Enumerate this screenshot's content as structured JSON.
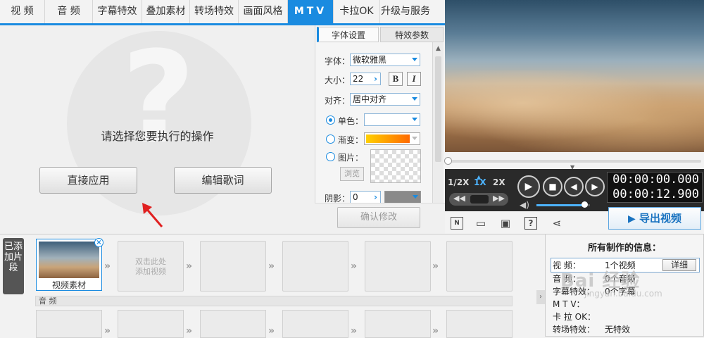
{
  "tabs": [
    {
      "label": "视 频"
    },
    {
      "label": "音 频"
    },
    {
      "label": "字幕特效"
    },
    {
      "label": "叠加素材"
    },
    {
      "label": "转场特效"
    },
    {
      "label": "画面风格"
    },
    {
      "label": "MTV"
    },
    {
      "label": "卡拉OK"
    },
    {
      "label": "升级与服务"
    }
  ],
  "action": {
    "prompt": "请选择您要执行的操作",
    "apply_label": "直接应用",
    "edit_label": "编辑歌词"
  },
  "font_panel": {
    "tab_font": "字体设置",
    "tab_effect": "特效参数",
    "font_label": "字体：",
    "font_value": "微软雅黑",
    "size_label": "大小：",
    "size_value": "22",
    "bold_label": "B",
    "italic_label": "I",
    "align_label": "对齐：",
    "align_value": "居中对齐",
    "solid_label": "单色：",
    "gradient_label": "渐变：",
    "image_label": "图片：",
    "browse_label": "浏览",
    "shadow_label": "阴影：",
    "shadow_value": "0",
    "confirm_label": "确认修改"
  },
  "player": {
    "speed_half": "1/2X",
    "speed_1x": "1X",
    "speed_2x": "2X",
    "time_current": "00:00:00.000",
    "time_total": "00:00:12.900",
    "progress": 0,
    "volume": 0.9,
    "export_label": "导出视频"
  },
  "timeline": {
    "side_label": "已添加片段",
    "clip_name": "视频素材",
    "add_hint_line1": "双击此处",
    "add_hint_line2": "添加视频",
    "audio_label": "音 频"
  },
  "info": {
    "title": "所有制作的信息：",
    "rows": [
      {
        "label": "视  频：",
        "value": "1个视频"
      },
      {
        "label": "音  频：",
        "value": "0个音频"
      },
      {
        "label": "字幕特效：",
        "value": "0个字幕"
      },
      {
        "label": "M  T  V：",
        "value": ""
      },
      {
        "label": "卡 拉 OK：",
        "value": ""
      },
      {
        "label": "转场特效：",
        "value": "无特效"
      }
    ],
    "detail_label": "详细"
  },
  "watermark": {
    "text": "Bai 经验",
    "url": "jingyan.baidu.com"
  },
  "colors": {
    "accent": "#1a8be0",
    "gradient_start": "#ffd000",
    "gradient_end": "#ff6a00",
    "arrow": "#e02020"
  },
  "icons": [
    "question-mark-icon",
    "arrow-up-icon",
    "play-icon",
    "stop-icon",
    "prev-icon",
    "next-icon",
    "volume-icon",
    "rewind-icon",
    "fast-forward-icon",
    "new-icon",
    "folder-icon",
    "save-icon",
    "help-icon",
    "share-icon",
    "export-icon",
    "close-icon",
    "chevron-right-icon"
  ]
}
